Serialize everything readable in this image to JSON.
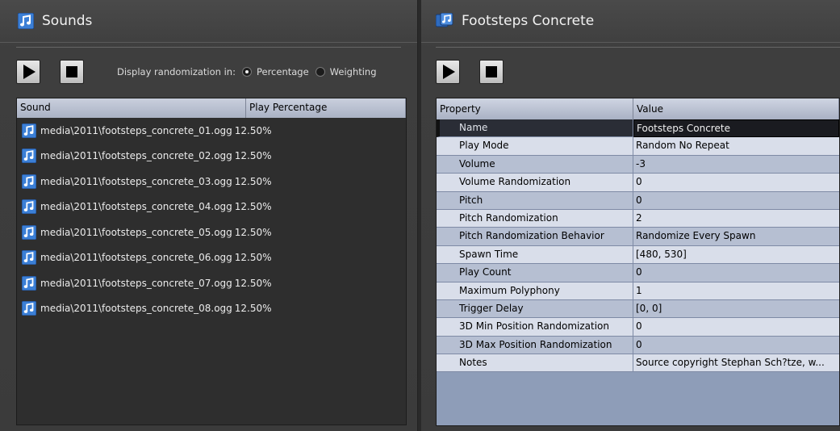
{
  "left": {
    "title": "Sounds",
    "rand_label": "Display randomization in:",
    "opt_percentage": "Percentage",
    "opt_weighting": "Weighting",
    "columns": [
      "Sound",
      "Play Percentage"
    ],
    "sounds": [
      {
        "file": "media\\2011\\footsteps_concrete_01.ogg",
        "pct": "12.50%"
      },
      {
        "file": "media\\2011\\footsteps_concrete_02.ogg",
        "pct": "12.50%"
      },
      {
        "file": "media\\2011\\footsteps_concrete_03.ogg",
        "pct": "12.50%"
      },
      {
        "file": "media\\2011\\footsteps_concrete_04.ogg",
        "pct": "12.50%"
      },
      {
        "file": "media\\2011\\footsteps_concrete_05.ogg",
        "pct": "12.50%"
      },
      {
        "file": "media\\2011\\footsteps_concrete_06.ogg",
        "pct": "12.50%"
      },
      {
        "file": "media\\2011\\footsteps_concrete_07.ogg",
        "pct": "12.50%"
      },
      {
        "file": "media\\2011\\footsteps_concrete_08.ogg",
        "pct": "12.50%"
      }
    ]
  },
  "right": {
    "title": "Footsteps Concrete",
    "columns": [
      "Property",
      "Value"
    ],
    "props": [
      {
        "name": "Name",
        "value": "Footsteps Concrete"
      },
      {
        "name": "Play Mode",
        "value": "Random No Repeat"
      },
      {
        "name": "Volume",
        "value": "-3"
      },
      {
        "name": "Volume Randomization",
        "value": "0"
      },
      {
        "name": "Pitch",
        "value": "0"
      },
      {
        "name": "Pitch Randomization",
        "value": "2"
      },
      {
        "name": "Pitch Randomization Behavior",
        "value": "Randomize Every Spawn"
      },
      {
        "name": "Spawn Time",
        "value": "[480, 530]"
      },
      {
        "name": "Play Count",
        "value": "0"
      },
      {
        "name": "Maximum Polyphony",
        "value": "1"
      },
      {
        "name": "Trigger Delay",
        "value": "[0, 0]"
      },
      {
        "name": "3D Min Position Randomization",
        "value": "0"
      },
      {
        "name": "3D Max Position Randomization",
        "value": "0"
      },
      {
        "name": "Notes",
        "value": "Source copyright Stephan Sch?tze, w..."
      }
    ]
  }
}
